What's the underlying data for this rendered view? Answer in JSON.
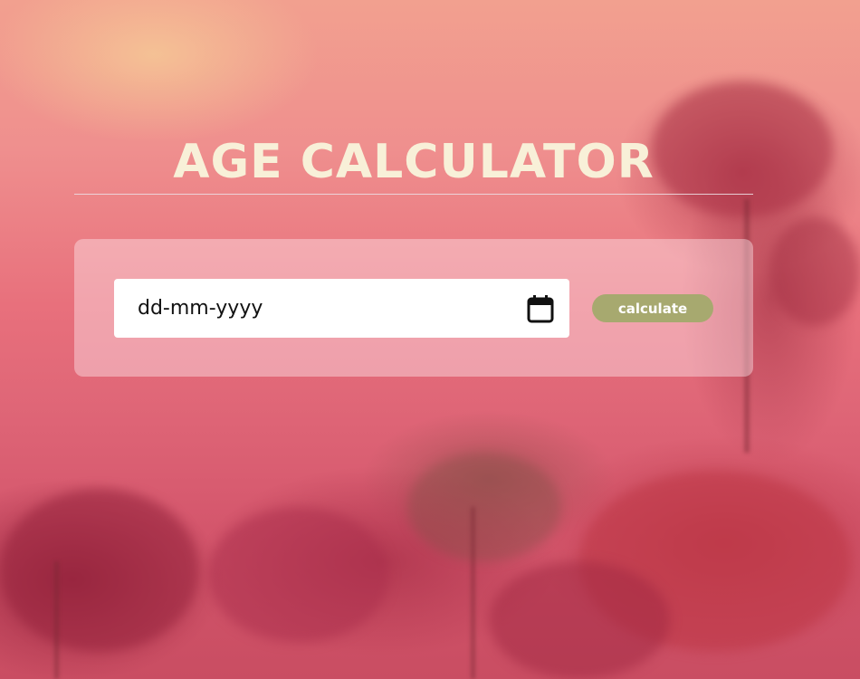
{
  "app": {
    "title": "AGE CALCULATOR"
  },
  "form": {
    "date_placeholder": "dd-mm-yyyy",
    "date_icon": "calendar-icon",
    "calculate_label": "calculate"
  },
  "colors": {
    "title_text": "#f8f0d8",
    "button_bg": "#a7a96f",
    "button_text": "#ffffff",
    "panel_bg": "rgba(255,235,240,0.42)",
    "background_accent": "#e8707c"
  }
}
